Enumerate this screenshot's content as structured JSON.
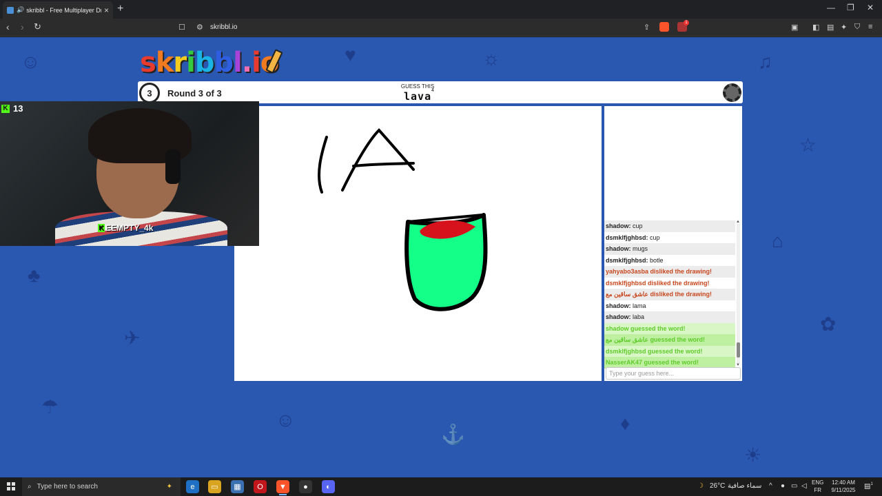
{
  "browser": {
    "tab_title": "skribbl - Free Multiplayer Dra",
    "url": "skribbl.io",
    "tab_close": "×",
    "new_tab": "+",
    "brave_badge": "1"
  },
  "game": {
    "logo": {
      "letters": [
        "s",
        "k",
        "r",
        "i",
        "b",
        "b",
        "l",
        ".",
        "i",
        "o"
      ],
      "colors": [
        "#e63b2e",
        "#f07a1f",
        "#f4cc1d",
        "#35c93f",
        "#19b3e6",
        "#2f5fe0",
        "#a743d6",
        "#f06fb2",
        "#e63b2e",
        "#f07a1f"
      ]
    },
    "clock_number": "3",
    "round_label": "Round 3 of 3",
    "guess_label": "GUESS THIS",
    "word": "lava",
    "word_length": "4"
  },
  "chat": {
    "messages": [
      {
        "type": "normal",
        "user": "shadow:",
        "text": " cup"
      },
      {
        "type": "normal",
        "user": "dsmklfjghbsd:",
        "text": " cup"
      },
      {
        "type": "normal",
        "user": "shadow:",
        "text": " mugs"
      },
      {
        "type": "normal",
        "user": "dsmklfjghbsd:",
        "text": " botle"
      },
      {
        "type": "dislike",
        "user": "",
        "text": "yahyabo3asba disliked the drawing!"
      },
      {
        "type": "dislike",
        "user": "",
        "text": "dsmklfjghbsd disliked the drawing!"
      },
      {
        "type": "dislike",
        "user": "",
        "text": "عاشق ساقين مع disliked the drawing!"
      },
      {
        "type": "normal",
        "user": "shadow:",
        "text": " lama"
      },
      {
        "type": "normal",
        "user": "shadow:",
        "text": " laba"
      },
      {
        "type": "correct",
        "user": "",
        "text": "shadow guessed the word!"
      },
      {
        "type": "correct",
        "user": "",
        "text": "عاشق ساقين مع guessed the word!"
      },
      {
        "type": "correct",
        "user": "",
        "text": "dsmklfjghbsd guessed the word!"
      },
      {
        "type": "correct",
        "user": "",
        "text": "NasserAK47 guessed the word!"
      }
    ],
    "input_placeholder": "Type your guess here..."
  },
  "stream": {
    "viewer_count": "13",
    "channel_name": "EEMPTY_4k"
  },
  "taskbar": {
    "search_placeholder": "Type here to search",
    "weather_temp": "26°C",
    "weather_desc": "سماء صافية",
    "lang_top": "ENG",
    "lang_bottom": "FR",
    "time": "12:40 AM",
    "date": "9/11/2025",
    "notif_count": "1"
  }
}
